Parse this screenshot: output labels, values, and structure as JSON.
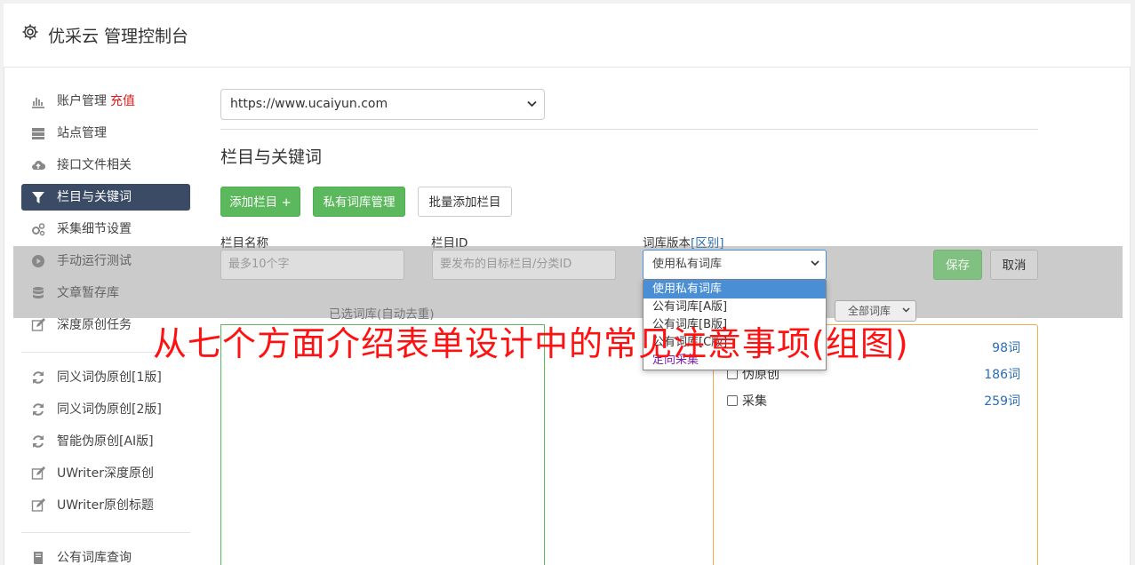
{
  "header": {
    "title": "优采云 管理控制台",
    "icon": "gear-icon"
  },
  "sidebar": {
    "items": [
      {
        "label": "账户管理",
        "badge": "充值",
        "icon": "bar-chart-icon"
      },
      {
        "label": "站点管理",
        "icon": "server-icon"
      },
      {
        "label": "接口文件相关",
        "icon": "cloud-upload-icon"
      },
      {
        "label": "栏目与关键词",
        "icon": "filter-icon",
        "active": true
      },
      {
        "label": "采集细节设置",
        "icon": "cogs-icon"
      },
      {
        "label": "手动运行测试",
        "icon": "play-circle-icon"
      },
      {
        "label": "文章暂存库",
        "icon": "database-icon"
      },
      {
        "label": "深度原创任务",
        "icon": "edit-icon"
      }
    ],
    "items2": [
      {
        "label": "同义词伪原创[1版]",
        "icon": "refresh-icon"
      },
      {
        "label": "同义词伪原创[2版]",
        "icon": "refresh-icon"
      },
      {
        "label": "智能伪原创[AI版]",
        "icon": "refresh-icon"
      },
      {
        "label": "UWriter深度原创",
        "icon": "edit-icon"
      },
      {
        "label": "UWriter原创标题",
        "icon": "edit-icon"
      }
    ],
    "items3": [
      {
        "label": "公有词库查询",
        "icon": "book-icon"
      }
    ]
  },
  "main": {
    "site_select": "https://www.ucaiyun.com",
    "section_title": "栏目与关键词",
    "buttons": {
      "add_column": "添加栏目 +",
      "private_lib": "私有词库管理",
      "batch_add": "批量添加栏目",
      "save": "保存",
      "cancel": "取消"
    },
    "form": {
      "name_label": "栏目名称",
      "name_placeholder": "最多10个字",
      "id_label": "栏目ID",
      "id_placeholder": "要发布的目标栏目/分类ID",
      "version_label": "词库版本",
      "version_link": "[区别]",
      "version_value": "使用私有词库"
    },
    "dropdown_options": [
      "使用私有词库",
      "公有词库[A版]",
      "公有词库[B版]",
      "公有词库[C版]",
      "定向采集"
    ],
    "selected_panel_label": "已选词库(自动去重)",
    "filter_value": "全部词库",
    "libraries": [
      {
        "name": "",
        "count": "98词"
      },
      {
        "name": "伪原创",
        "count": "186词"
      },
      {
        "name": "采集",
        "count": "259词"
      }
    ]
  },
  "watermark": "从七个方面介绍表单设计中的常见注意事项(组图)",
  "colors": {
    "green": "#5cb85c",
    "active_nav": "#3b4b66",
    "link": "#2a6db5",
    "watermark": "#ff1111"
  }
}
